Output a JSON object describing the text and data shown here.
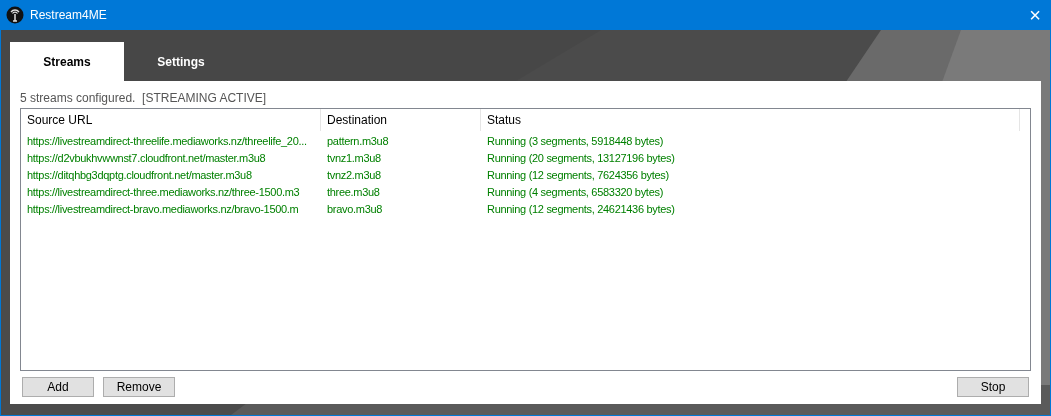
{
  "window": {
    "title": "Restream4ME",
    "close": "×"
  },
  "tabs": [
    {
      "label": "Streams",
      "selected": true
    },
    {
      "label": "Settings",
      "selected": false
    }
  ],
  "status_text": "5 streams configured.  [STREAMING ACTIVE]",
  "table": {
    "columns": [
      "Source URL",
      "Destination",
      "Status"
    ],
    "rows": [
      {
        "source": "https://livestreamdirect-threelife.mediaworks.nz/threelife_20...",
        "destination": "pattern.m3u8",
        "status": "Running (3 segments, 5918448 bytes)"
      },
      {
        "source": "https://d2vbukhvwwnst7.cloudfront.net/master.m3u8",
        "destination": "tvnz1.m3u8",
        "status": "Running (20 segments, 13127196 bytes)"
      },
      {
        "source": "https://ditqhbg3dqptg.cloudfront.net/master.m3u8",
        "destination": "tvnz2.m3u8",
        "status": "Running (12 segments, 7624356 bytes)"
      },
      {
        "source": "https://livestreamdirect-three.mediaworks.nz/three-1500.m3",
        "destination": "three.m3u8",
        "status": "Running (4 segments, 6583320 bytes)"
      },
      {
        "source": "https://livestreamdirect-bravo.mediaworks.nz/bravo-1500.m",
        "destination": "bravo.m3u8",
        "status": "Running (12 segments, 24621436 bytes)"
      }
    ]
  },
  "buttons_left": [
    "Add",
    "Remove"
  ],
  "buttons_right": [
    "Stop"
  ]
}
